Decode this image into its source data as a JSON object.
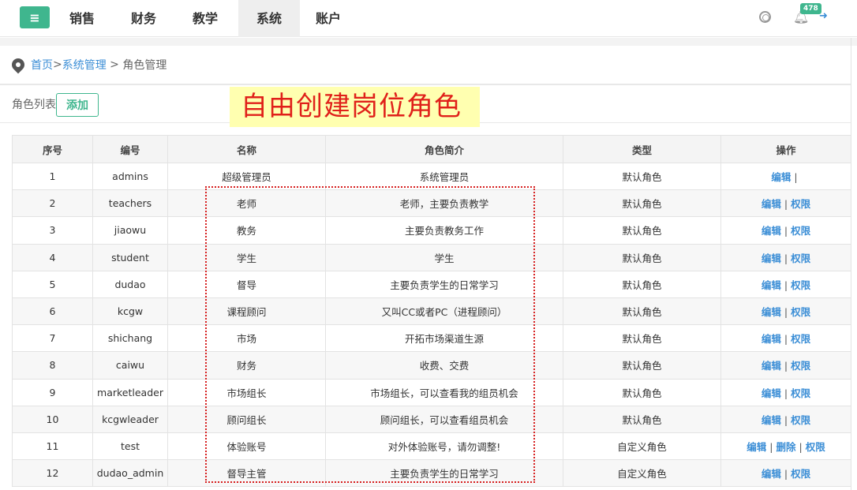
{
  "nav": {
    "menu_icon": "hamburger-icon",
    "items": [
      {
        "label": "销售"
      },
      {
        "label": "财务"
      },
      {
        "label": "教学"
      },
      {
        "label": "系统"
      },
      {
        "label": "账户"
      }
    ],
    "active": "系统",
    "notification_count": "478"
  },
  "breadcrumb": {
    "home": "首页",
    "sep1": ">",
    "section": "系统管理",
    "sep2": " > ",
    "current": "角色管理"
  },
  "toolbar": {
    "list_label": "角色列表",
    "add_label": "添加"
  },
  "annotation": "自由创建岗位角色",
  "table": {
    "headers": [
      "序号",
      "编号",
      "名称",
      "角色简介",
      "类型",
      "操作"
    ],
    "rows": [
      {
        "no": "1",
        "code": "admins",
        "name": "超级管理员",
        "desc": "系统管理员",
        "type": "默认角色"
      },
      {
        "no": "2",
        "code": "teachers",
        "name": "老师",
        "desc": "老师，主要负责教学",
        "type": "默认角色"
      },
      {
        "no": "3",
        "code": "jiaowu",
        "name": "教务",
        "desc": "主要负责教务工作",
        "type": "默认角色"
      },
      {
        "no": "4",
        "code": "student",
        "name": "学生",
        "desc": "学生",
        "type": "默认角色"
      },
      {
        "no": "5",
        "code": "dudao",
        "name": "督导",
        "desc": "主要负责学生的日常学习",
        "type": "默认角色"
      },
      {
        "no": "6",
        "code": "kcgw",
        "name": "课程顾问",
        "desc": "又叫CC或者PC（进程顾问）",
        "type": "默认角色"
      },
      {
        "no": "7",
        "code": "shichang",
        "name": "市场",
        "desc": "开拓市场渠道生源",
        "type": "默认角色"
      },
      {
        "no": "8",
        "code": "caiwu",
        "name": "财务",
        "desc": "收费、交费",
        "type": "默认角色"
      },
      {
        "no": "9",
        "code": "marketleader",
        "name": "市场组长",
        "desc": "市场组长，可以查看我的组员机会",
        "type": "默认角色"
      },
      {
        "no": "10",
        "code": "kcgwleader",
        "name": "顾问组长",
        "desc": "顾问组长，可以查看组员机会",
        "type": "默认角色"
      },
      {
        "no": "11",
        "code": "test",
        "name": "体验账号",
        "desc": "对外体验账号，请勿调整!",
        "type": "自定义角色"
      },
      {
        "no": "12",
        "code": "dudao_admin",
        "name": "督导主管",
        "desc": "主要负责学生的日常学习",
        "type": "自定义角色"
      }
    ],
    "ops": {
      "edit": "编辑",
      "delete": "删除",
      "perm": "权限",
      "sep": "|"
    }
  }
}
